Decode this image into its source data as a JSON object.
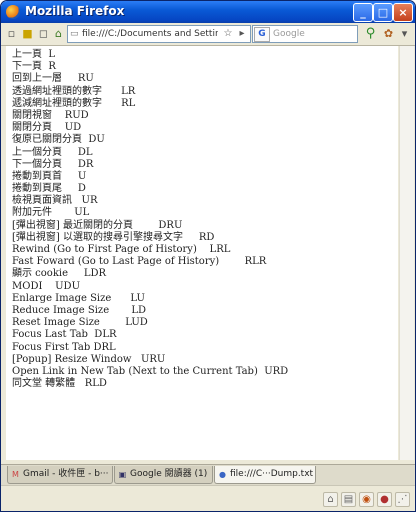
{
  "window": {
    "title": "Mozilla Firefox",
    "buttons": {
      "minimize": "_",
      "maximize": "□",
      "close": "×"
    }
  },
  "toolbar": {
    "url": "file:///C:/Documents and Settings/Ad",
    "search_placeholder": "Google",
    "search_engine_glyph": "G"
  },
  "content": {
    "lines": [
      "上一頁  L",
      "下一頁  R",
      "回到上一層     RU",
      "透過網址裡頭的數字      LR",
      "遞減網址裡頭的數字      RL",
      "關閉視窗    RUD",
      "關閉分頁    UD",
      "復原已關閉分頁  DU",
      "上一個分頁     DL",
      "下一個分頁     DR",
      "捲動到頁首     U",
      "捲動到頁尾     D",
      "檢視頁面資訊   UR",
      "附加元件       UL",
      "[彈出視窗] 最近關閉的分頁        DRU",
      "[彈出視窗] 以選取的搜尋引擎搜尋文字     RD",
      "Rewind (Go to First Page of History)    LRL",
      "Fast Foward (Go to Last Page of History)        RLR",
      "顯示 cookie     LDR",
      "MODI    UDU",
      "Enlarge Image Size      LU",
      "Reduce Image Size       LD",
      "Reset Image Size        LUD",
      "Focus Last Tab  DLR",
      "Focus First Tab DRL",
      "[Popup] Resize Window   URU",
      "Open Link in New Tab (Next to the Current Tab)  URD",
      "同文堂 轉繁體   RLD"
    ]
  },
  "tabs": [
    {
      "label": "Gmail - 收件匣 - b···",
      "icon": "gmail-icon",
      "glyph": "M",
      "active": false
    },
    {
      "label": "Google 閱讀器 (1)",
      "icon": "reader-icon",
      "glyph": "▣",
      "active": false
    },
    {
      "label": "file:///C···Dump.txt",
      "icon": "file-icon",
      "glyph": "●",
      "active": true
    }
  ],
  "colors": {
    "titlebar": "#0a5ad6",
    "window_frame": "#0a246a",
    "chrome": "#ece9d8"
  }
}
